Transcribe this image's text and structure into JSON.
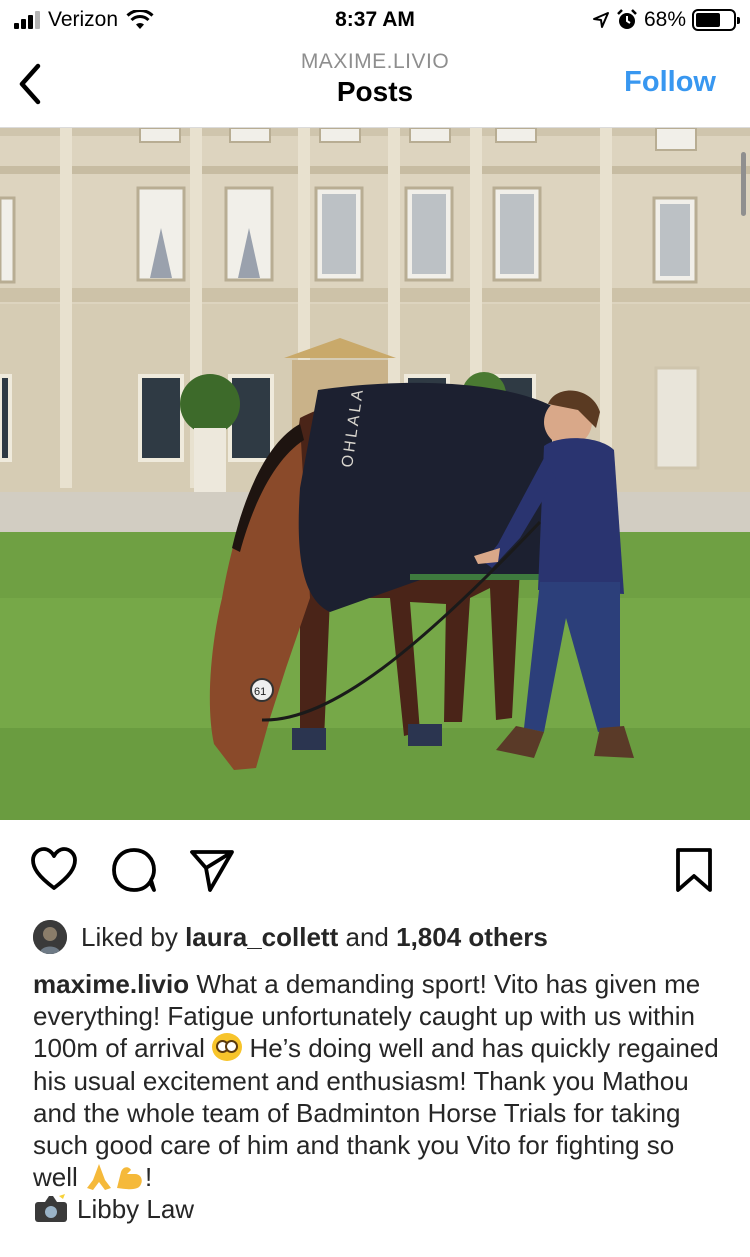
{
  "status_bar": {
    "carrier": "Verizon",
    "time": "8:37 AM",
    "battery": "68%",
    "battery_level": 0.68
  },
  "header": {
    "username": "MAXIME.LIVIO",
    "title": "Posts",
    "follow_label": "Follow"
  },
  "photo": {
    "blanket_text": "OHLALA",
    "bridle_number": "61"
  },
  "actions": {
    "icons": [
      "heart-icon",
      "comment-icon",
      "share-icon",
      "bookmark-icon"
    ]
  },
  "likes": {
    "prefix": "Liked by",
    "user": "laura_collett",
    "middle": "and",
    "count": "1,804 others"
  },
  "caption": {
    "username": "maxime.livio",
    "text_1": "What a demanding sport! Vito has given me everything! Fatigue unfortunately caught up with us within 100m of arrival",
    "text_2": "He’s doing well and has quickly regained his usual excitement and enthusiasm! Thank you Mathou and the whole team of Badminton Horse Trials for taking such good care of him and thank you Vito for fighting so well",
    "text_3": "!",
    "photo_credit": "Libby Law"
  },
  "colors": {
    "accent": "#3897f0",
    "text": "#262626",
    "secondary": "#8e8e8e"
  }
}
